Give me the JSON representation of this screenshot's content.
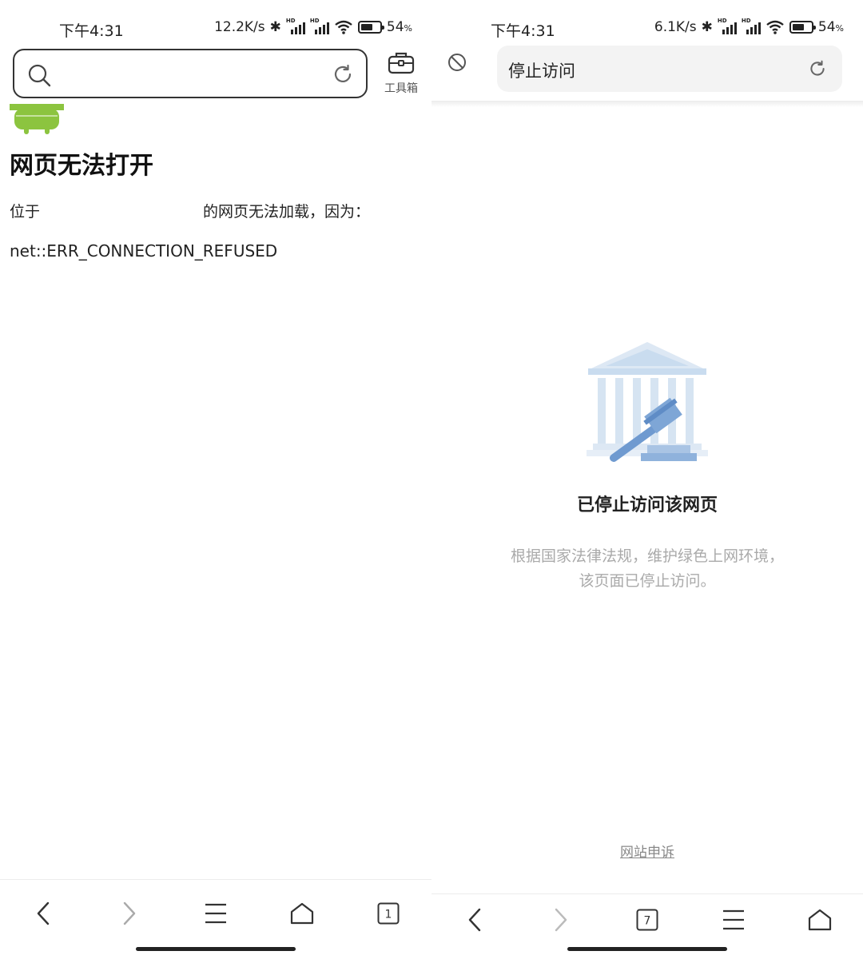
{
  "left": {
    "status": {
      "time": "下午4:31",
      "speed": "12.2K/s",
      "hd1": "HD",
      "hd2": "HD",
      "battery_pct": "54",
      "battery_unit": "%",
      "battery_level": 0.54
    },
    "toolbox_label": "工具箱",
    "error": {
      "title": "网页无法打开",
      "msg_prefix": "位于",
      "msg_suffix": "的网页无法加载，因为：",
      "code": "net::ERR_CONNECTION_REFUSED"
    },
    "tab_count": "1"
  },
  "right": {
    "status": {
      "time": "下午4:31",
      "speed": "6.1K/s",
      "hd1": "HD",
      "hd2": "HD",
      "battery_pct": "54",
      "battery_unit": "%",
      "battery_level": 0.54
    },
    "url_text": "停止访问",
    "block": {
      "title": "已停止访问该网页",
      "desc_line1": "根据国家法律法规，维护绿色上网环境，",
      "desc_line2": "该页面已停止访问。"
    },
    "appeal_link": "网站申诉",
    "tab_count": "7"
  },
  "colors": {
    "android_green": "#8cc43f",
    "court_blue": "#c9dcef",
    "gavel_blue": "#6f9ad0"
  }
}
